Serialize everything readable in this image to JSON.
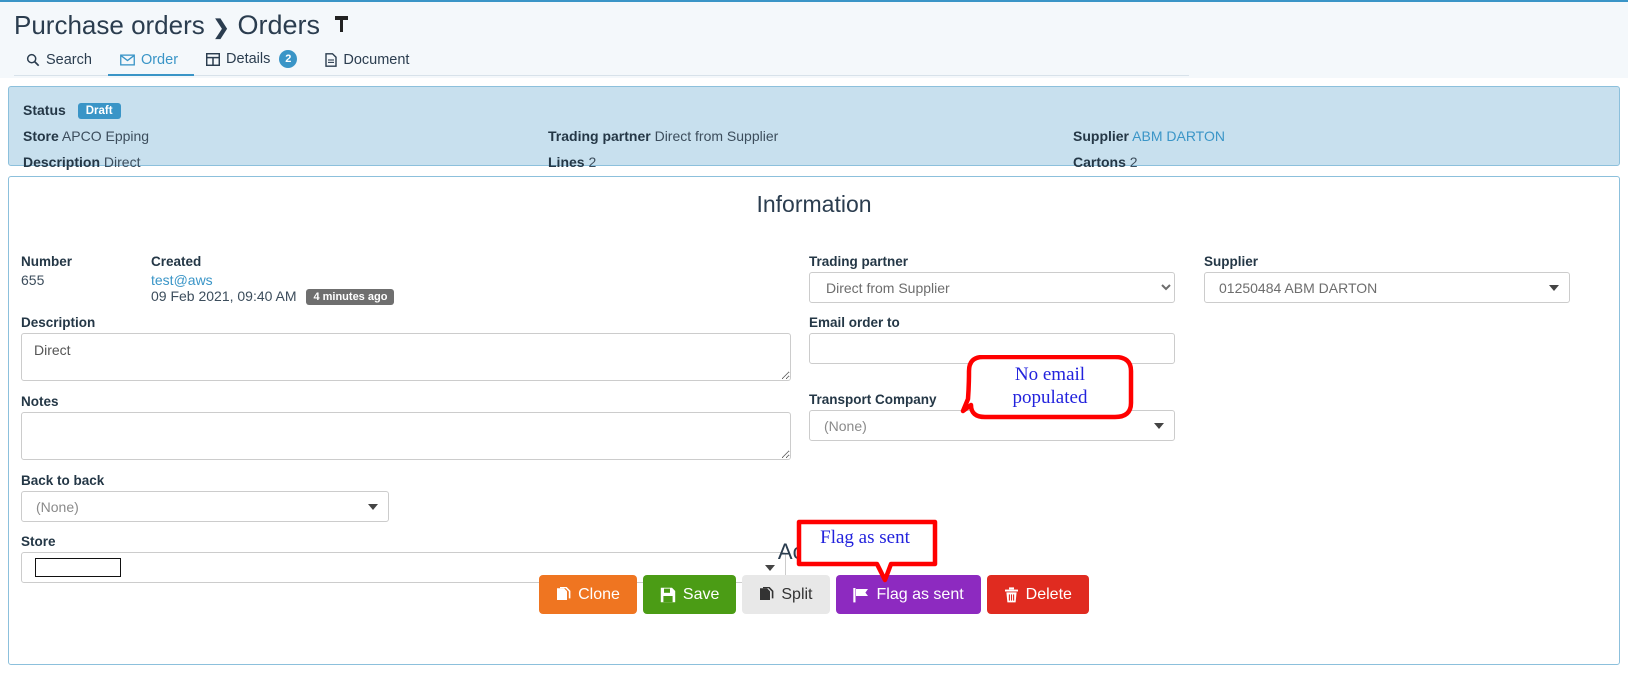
{
  "breadcrumb": {
    "parent": "Purchase orders",
    "separator": "❯",
    "current": "Orders",
    "pin_icon": "pin-icon"
  },
  "tabs": [
    {
      "label": "Search",
      "icon": "search-icon",
      "active": false,
      "badge": ""
    },
    {
      "label": "Order",
      "icon": "envelope-icon",
      "active": true,
      "badge": ""
    },
    {
      "label": "Details",
      "icon": "table-icon",
      "active": false,
      "badge": "2"
    },
    {
      "label": "Document",
      "icon": "file-icon",
      "active": false,
      "badge": ""
    }
  ],
  "status_panel": {
    "status_label": "Status",
    "status_value": "Draft",
    "store_label": "Store",
    "store_value": "APCO Epping",
    "description_label": "Description",
    "description_value": "Direct",
    "trading_partner_label": "Trading partner",
    "trading_partner_value": "Direct from Supplier",
    "lines_label": "Lines",
    "lines_value": "2",
    "supplier_label": "Supplier",
    "supplier_value": "ABM DARTON",
    "cartons_label": "Cartons",
    "cartons_value": "2"
  },
  "information": {
    "title": "Information",
    "number_label": "Number",
    "number_value": "655",
    "created_label": "Created",
    "created_user": "test@aws",
    "created_date": "09 Feb 2021, 09:40 AM",
    "created_ago": "4 minutes ago",
    "description_label": "Description",
    "description_value": "Direct",
    "notes_label": "Notes",
    "notes_value": "",
    "notes_placeholder": "",
    "back_to_back_label": "Back to back",
    "back_to_back_value": "(None)",
    "store_label": "Store",
    "store_value": "",
    "trading_partner_label": "Trading partner",
    "trading_partner_value": "Direct from Supplier",
    "email_order_to_label": "Email order to",
    "email_order_to_value": "",
    "email_order_to_placeholder": "",
    "transport_company_label": "Transport Company",
    "transport_company_value": "(None)",
    "supplier_label": "Supplier",
    "supplier_value": "01250484 ABM DARTON"
  },
  "actions": {
    "title": "Actions",
    "buttons": [
      {
        "label": "Clone",
        "icon": "copy-icon",
        "color": "#ef7521"
      },
      {
        "label": "Save",
        "icon": "save-icon",
        "color": "#4b9c15"
      },
      {
        "label": "Split",
        "icon": "copy-icon",
        "color": "#e8e8e8"
      },
      {
        "label": "Flag as sent",
        "icon": "flag-icon",
        "color": "#8d2ac0"
      },
      {
        "label": "Delete",
        "icon": "trash-icon",
        "color": "#e02b20"
      }
    ]
  },
  "annotations": [
    {
      "text": "No email\npopulated",
      "color": "#2222dd",
      "border": "#ff0000"
    },
    {
      "text": "Flag as sent",
      "color": "#2222dd",
      "border": "#ff0000"
    }
  ],
  "annotation_texts": {
    "email_line1": "No email",
    "email_line2": "populated",
    "flag": "Flag as sent"
  },
  "colors": {
    "accent": "#3a95c7",
    "status_bg": "#c8e0ee",
    "annotation_border": "#ff0000",
    "annotation_text": "#2222dd"
  }
}
